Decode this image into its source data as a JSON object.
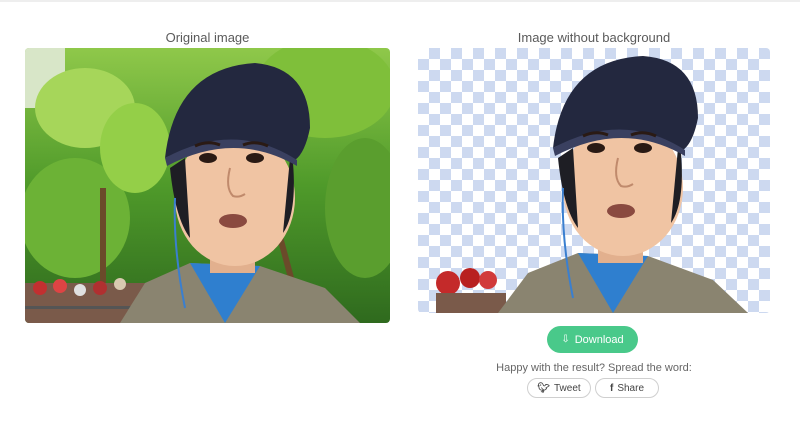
{
  "columns": {
    "left_title": "Original image",
    "right_title": "Image without background"
  },
  "actions": {
    "download_label": "Download",
    "download_icon": "download-icon"
  },
  "share": {
    "prompt": "Happy with the result? Spread the word:",
    "tweet_label": "Tweet",
    "tweet_icon": "twitter-bird-icon",
    "share_label": "Share",
    "share_icon": "facebook-f-icon"
  },
  "colors": {
    "accent": "#49c98a",
    "checker": "#cdd9f0",
    "title_text": "#5a5a5a"
  }
}
